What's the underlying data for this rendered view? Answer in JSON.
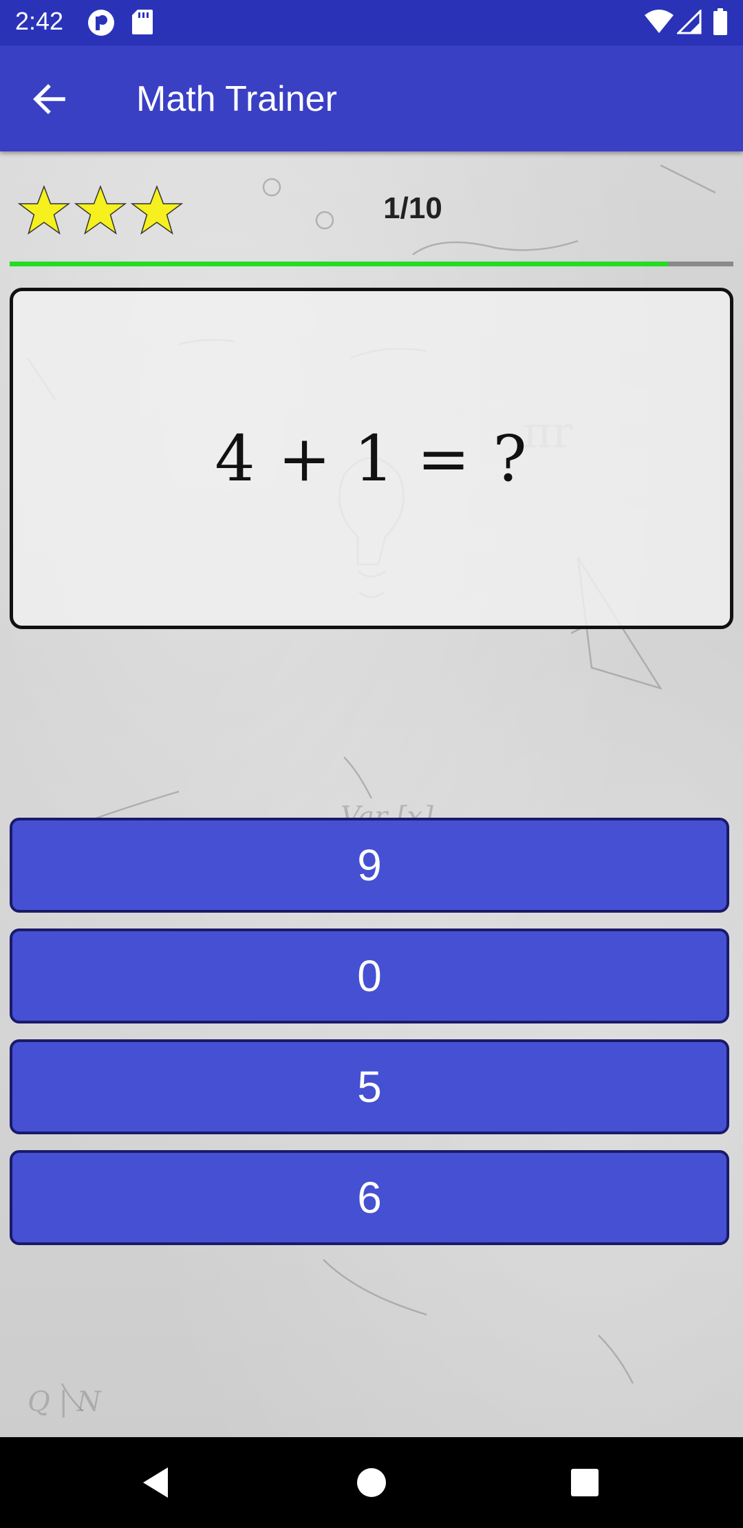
{
  "status_bar": {
    "time": "2:42",
    "icons": [
      "notification-app-icon",
      "sd-card-icon",
      "wifi-icon",
      "signal-icon",
      "battery-icon"
    ]
  },
  "app_bar": {
    "title": "Math Trainer",
    "back_icon": "arrow-left-icon"
  },
  "quiz": {
    "stars": {
      "count": 3,
      "color": "#f5f01e"
    },
    "progress_label": "1/10",
    "progress_fraction": 0.91,
    "question": "4 + 1 = ?",
    "answers": [
      "9",
      "0",
      "5",
      "6"
    ]
  },
  "nav_bar": {
    "icons": [
      "back-triangle-icon",
      "home-circle-icon",
      "recents-square-icon"
    ]
  },
  "colors": {
    "status_bar": "#2a33b8",
    "app_bar": "#3a40c4",
    "answer_button": "#4650d2",
    "progress": "#22dd22"
  }
}
